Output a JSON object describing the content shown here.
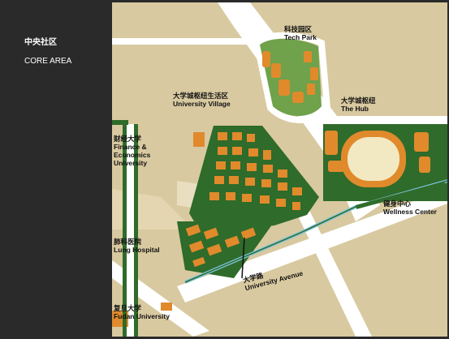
{
  "header": {
    "title_cn": "中央社区",
    "title_en": "CORE AREA"
  },
  "map": {
    "labels": {
      "tech_park_cn": "科技园区",
      "tech_park_en": "Tech Park",
      "university_village_cn": "大学城枢纽生活区",
      "university_village_en": "University Village",
      "hub_cn": "大学城枢纽",
      "hub_en": "The Hub",
      "finance_cn": "财经大学",
      "finance_en_1": "Finance &",
      "finance_en_2": "Economics",
      "finance_en_3": "University",
      "wellness_cn": "健身中心",
      "wellness_en": "Wellness Center",
      "lung_cn": "肺科医院",
      "lung_en": "Lung Hospital",
      "avenue_cn": "大学路",
      "avenue_en": "University Avenue",
      "fudan_cn": "复旦大学",
      "fudan_en": "Fudan University"
    },
    "colors": {
      "ground": "#d8c9a0",
      "road": "#ffffff",
      "green": "#2f6b2a",
      "light_green": "#6fa24a",
      "building": "#e08a2c",
      "plaza": "#eee4c8",
      "water": "#7fc6de",
      "track": "#f2e9c2"
    }
  }
}
